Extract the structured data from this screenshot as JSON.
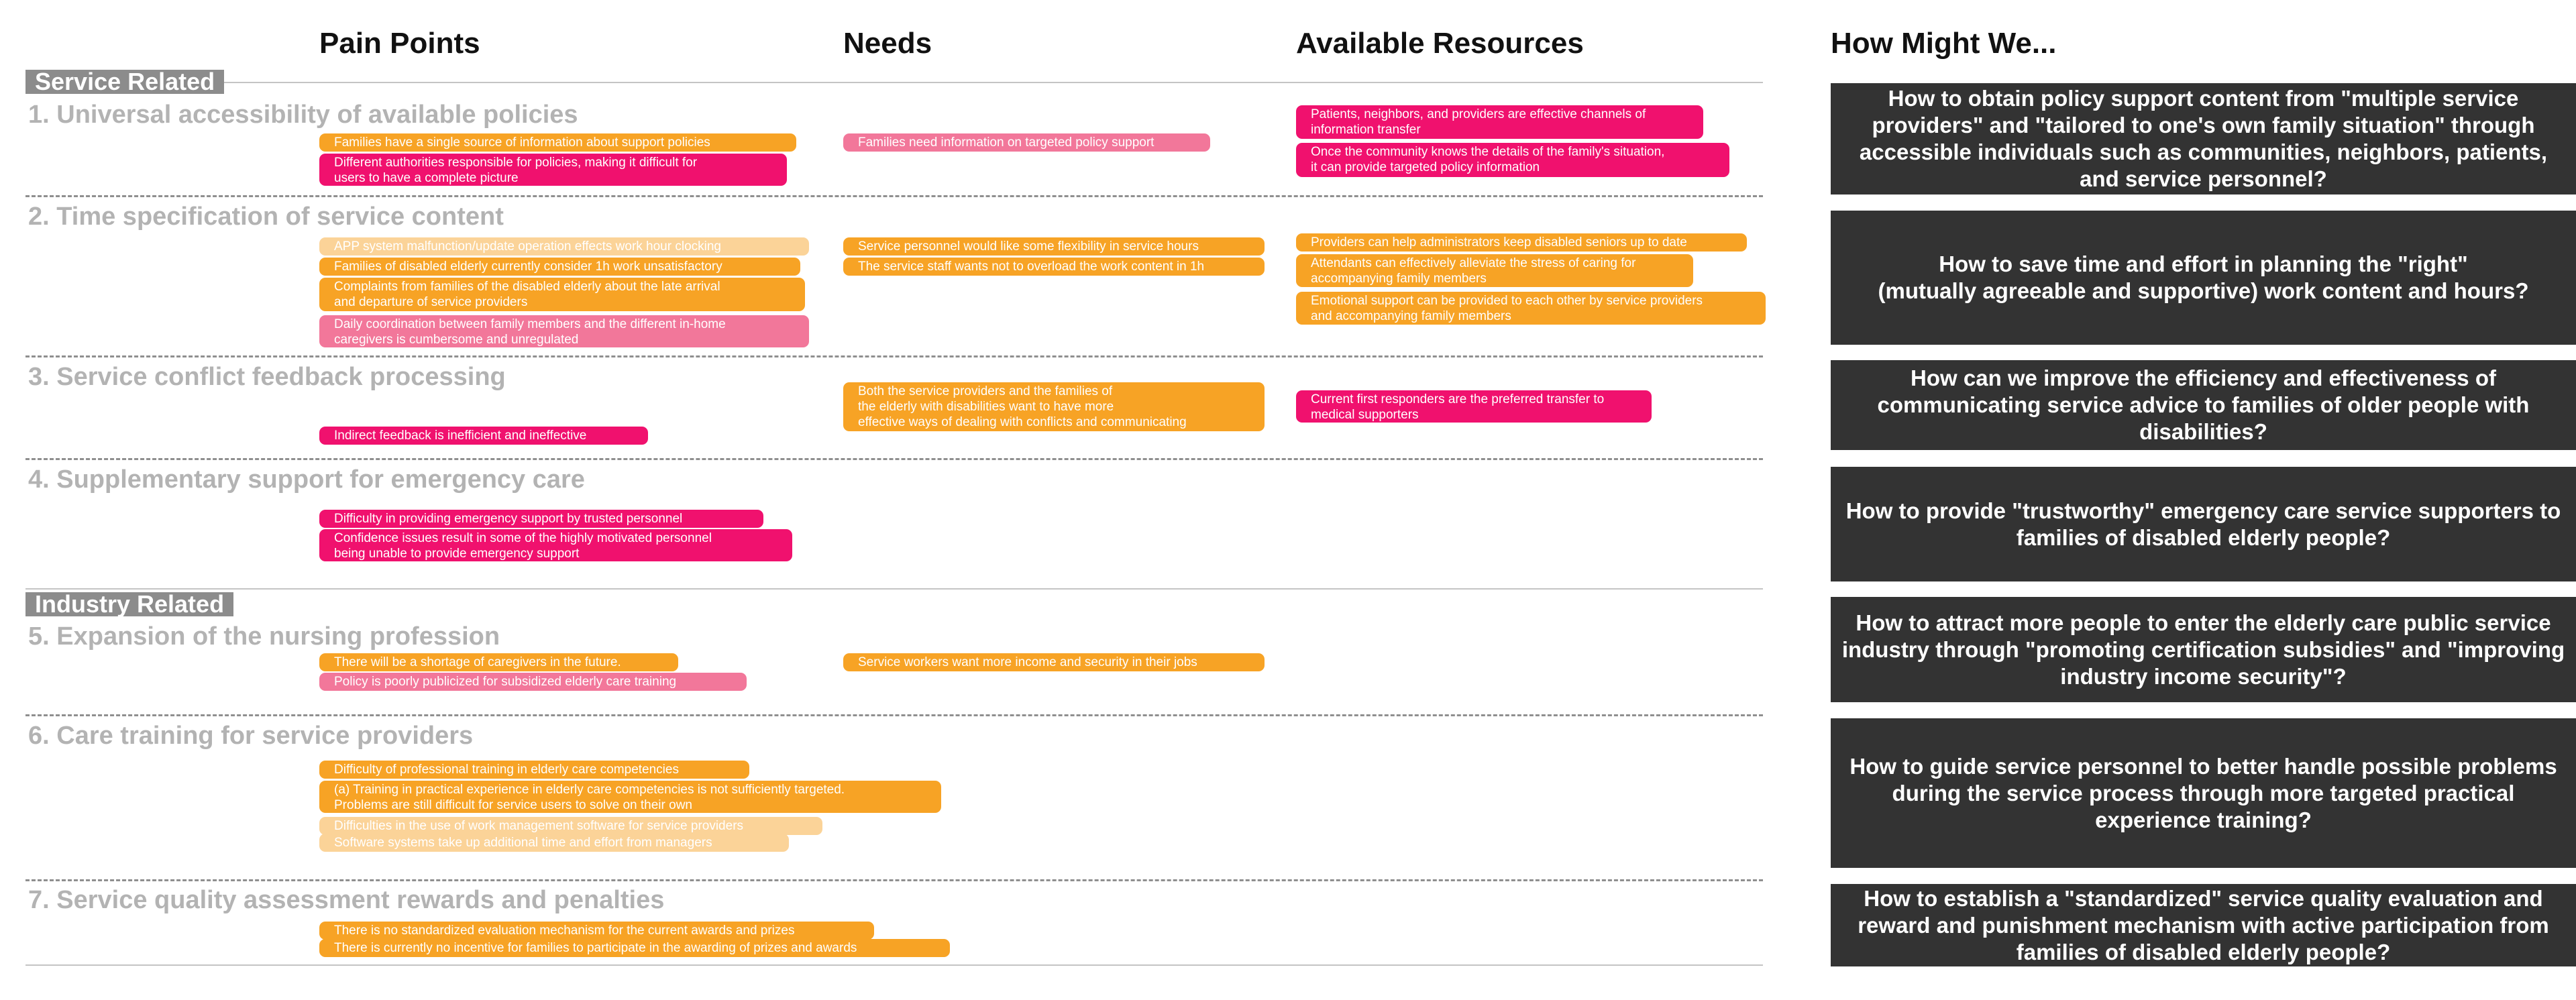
{
  "columns": {
    "pain_points": "Pain Points",
    "needs": "Needs",
    "resources": "Available Resources",
    "hmw": "How Might We..."
  },
  "bands": {
    "service": "Service Related",
    "industry": "Industry Related"
  },
  "colors": {
    "orange": "#f7a325",
    "magenta": "#f0116e",
    "pink": "#f2779a",
    "peach": "#fbd398",
    "hmw_background": "#333333",
    "band_background": "#8c8c8c",
    "category_text": "#b3b3b3"
  },
  "categories": [
    {
      "title": "1. Universal accessibility of available policies",
      "pain_points": [
        {
          "text": "Families have a single source of information about support policies",
          "color": "orange"
        },
        {
          "text": "Different authorities responsible for policies, making it difficult for\nusers to have a complete picture",
          "color": "magenta"
        }
      ],
      "needs": [
        {
          "text": "Families need information on targeted policy support",
          "color": "pink"
        }
      ],
      "resources": [
        {
          "text": "Patients, neighbors, and providers are effective channels of\ninformation transfer",
          "color": "magenta"
        },
        {
          "text": "Once the community knows the details of the family's situation,\nit can provide targeted policy information",
          "color": "magenta"
        }
      ],
      "hmw": "How to obtain policy support content from \"multiple service providers\" and \"tailored to one's own family situation\" through accessible individuals such as communities, neighbors, patients, and service personnel?"
    },
    {
      "title": "2. Time specification of service content",
      "pain_points": [
        {
          "text": "APP system malfunction/update operation effects work hour clocking",
          "color": "peach"
        },
        {
          "text": "Families of disabled elderly currently consider 1h work unsatisfactory",
          "color": "orange"
        },
        {
          "text": "Complaints from families of the disabled elderly about the late arrival\nand departure of service providers",
          "color": "orange"
        },
        {
          "text": "Daily coordination between family members and the different in-home\ncaregivers is cumbersome and unregulated",
          "color": "pink"
        }
      ],
      "needs": [
        {
          "text": "Service personnel would like some flexibility in service hours",
          "color": "orange"
        },
        {
          "text": "The service staff wants not to overload the work content in 1h",
          "color": "orange"
        }
      ],
      "resources": [
        {
          "text": "Providers can help administrators keep disabled seniors up to date",
          "color": "orange"
        },
        {
          "text": "Attendants can effectively alleviate the stress of caring for\naccompanying family members",
          "color": "orange"
        },
        {
          "text": "Emotional support can be provided to each other by service providers\nand accompanying family members",
          "color": "orange"
        }
      ],
      "hmw": "How to save time and effort in planning the \"right\"\n(mutually agreeable and supportive) work content and hours?"
    },
    {
      "title": "3. Service conflict feedback processing",
      "pain_points": [
        {
          "text": "Indirect feedback is inefficient and ineffective",
          "color": "magenta"
        }
      ],
      "needs": [
        {
          "text": "Both the service providers and the families of\nthe elderly with disabilities want  to have more\neffective ways of dealing with conflicts and communicating",
          "color": "orange"
        }
      ],
      "resources": [
        {
          "text": "Current first responders are the preferred transfer to\nmedical supporters",
          "color": "magenta"
        }
      ],
      "hmw": "How can we improve the efficiency and effectiveness of communicating service advice to families of older people with disabilities?"
    },
    {
      "title": "4. Supplementary support for emergency care",
      "pain_points": [
        {
          "text": "Difficulty in providing emergency support by trusted personnel",
          "color": "magenta"
        },
        {
          "text": "Confidence issues result in some of the highly motivated personnel\nbeing unable to provide emergency support",
          "color": "magenta"
        }
      ],
      "needs": [],
      "resources": [],
      "hmw": "How to provide \"trustworthy\" emergency care service supporters to families of disabled elderly people?"
    },
    {
      "title": "5. Expansion of the nursing profession",
      "pain_points": [
        {
          "text": "There will be a shortage of caregivers in the future.",
          "color": "orange"
        },
        {
          "text": "Policy is poorly publicized for subsidized elderly care training",
          "color": "pink"
        }
      ],
      "needs": [
        {
          "text": "Service workers want more income and security in their jobs",
          "color": "orange"
        }
      ],
      "resources": [],
      "hmw": "How to attract more people to enter the elderly care public service industry through \"promoting certification subsidies\" and \"improving industry income security\"?"
    },
    {
      "title": "6. Care training for service providers",
      "pain_points": [
        {
          "text": "Difficulty of professional training in elderly care competencies",
          "color": "orange"
        },
        {
          "text": "(a) Training in practical experience in elderly care competencies is not sufficiently targeted.\nProblems are still difficult for service users to solve on their own",
          "color": "orange"
        },
        {
          "text": "Difficulties in the use of work management software for service providers",
          "color": "peach"
        },
        {
          "text": "Software systems take up additional time and effort from managers",
          "color": "peach"
        }
      ],
      "needs": [],
      "resources": [],
      "hmw": "How to guide service personnel to better handle possible problems during the service process through more targeted practical experience training?"
    },
    {
      "title": "7. Service quality assessment rewards and penalties",
      "pain_points": [
        {
          "text": "There is no standardized evaluation mechanism for the current awards and prizes",
          "color": "orange"
        },
        {
          "text": "There is currently no incentive for families to participate in the awarding of prizes and awards",
          "color": "orange"
        }
      ],
      "needs": [],
      "resources": [],
      "hmw": "How to establish a \"standardized\" service quality evaluation and reward and punishment mechanism with active participation from families of disabled elderly people?"
    }
  ]
}
